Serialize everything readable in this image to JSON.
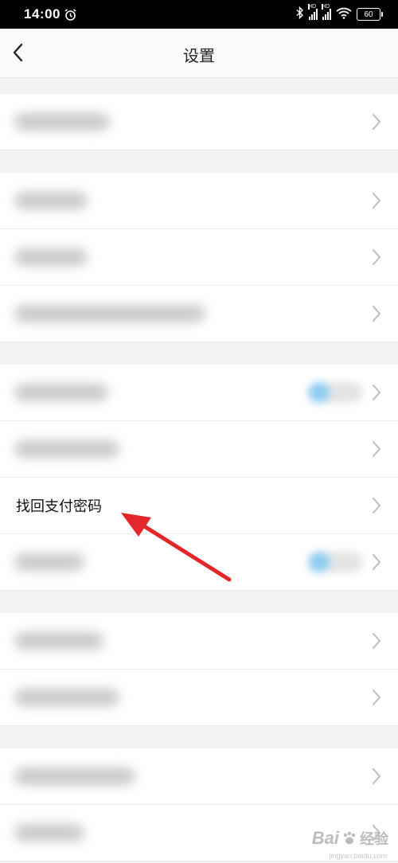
{
  "status_bar": {
    "time": "14:00",
    "battery": "60",
    "hd_label": "HD",
    "icons": [
      "alarm-icon",
      "bluetooth-icon",
      "signal-icon",
      "signal-icon",
      "wifi-icon",
      "battery-icon"
    ]
  },
  "nav": {
    "title": "设置",
    "back_icon": "chevron-left-icon"
  },
  "settings": {
    "visible_item": "找回支付密码"
  },
  "watermark": {
    "text": "Bai",
    "text2": "经验",
    "url": "jingyan.baidu.com"
  },
  "colors": {
    "accent_arrow": "#e3262a",
    "toggle_blue": "#8dcdf2"
  }
}
